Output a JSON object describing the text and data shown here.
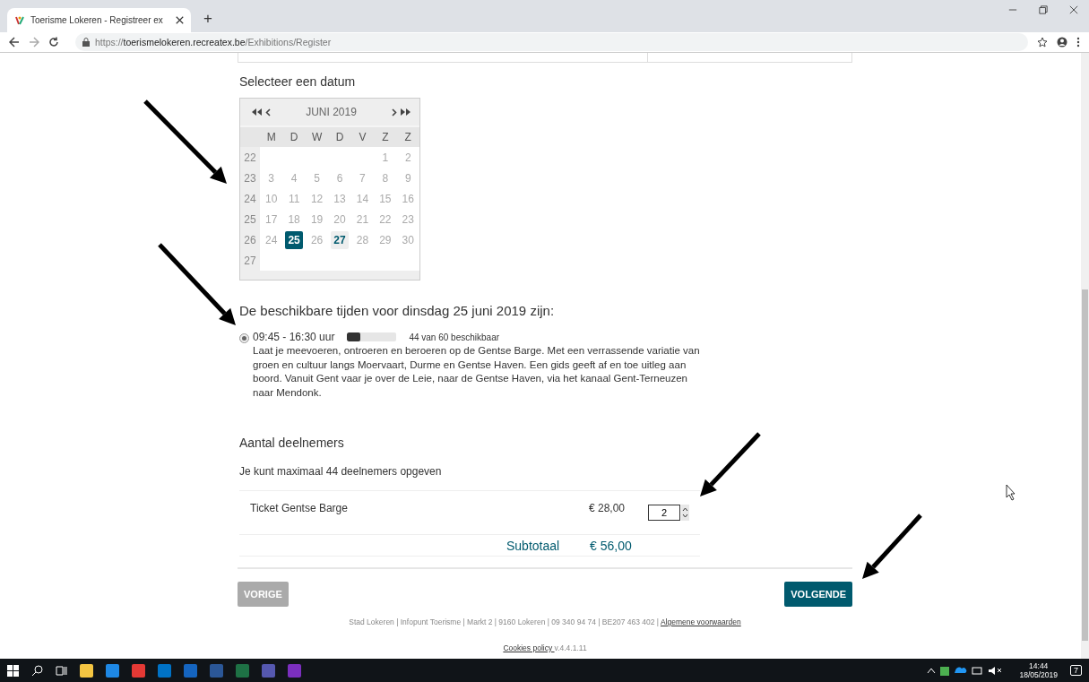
{
  "browser": {
    "tab_title": "Toerisme Lokeren - Registreer ex",
    "new_tab": "+",
    "url": {
      "scheme": "https://",
      "host": "toerismelokeren.recreatex.be",
      "path": "/Exhibitions/Register"
    }
  },
  "date_section": {
    "heading": "Selecteer een datum",
    "calendar": {
      "month": "JUNI 2019",
      "weekdays": [
        "M",
        "D",
        "W",
        "D",
        "V",
        "Z",
        "Z"
      ],
      "weeks": [
        {
          "number": "22",
          "days": [
            {
              "label": "1",
              "available": false,
              "selected": false
            },
            {
              "label": "2",
              "available": false,
              "selected": false
            }
          ]
        },
        {
          "number": "23",
          "days": [
            {
              "label": "3",
              "available": false,
              "selected": false
            },
            {
              "label": "4",
              "available": false,
              "selected": false
            },
            {
              "label": "5",
              "available": false,
              "selected": false
            },
            {
              "label": "6",
              "available": false,
              "selected": false
            },
            {
              "label": "7",
              "available": false,
              "selected": false
            },
            {
              "label": "8",
              "available": false,
              "selected": false
            },
            {
              "label": "9",
              "available": false,
              "selected": false
            }
          ]
        },
        {
          "number": "24",
          "days": [
            {
              "label": "10",
              "available": false,
              "selected": false
            },
            {
              "label": "11",
              "available": false,
              "selected": false
            },
            {
              "label": "12",
              "available": false,
              "selected": false
            },
            {
              "label": "13",
              "available": false,
              "selected": false
            },
            {
              "label": "14",
              "available": false,
              "selected": false
            },
            {
              "label": "15",
              "available": false,
              "selected": false
            },
            {
              "label": "16",
              "available": false,
              "selected": false
            }
          ]
        },
        {
          "number": "25",
          "days": [
            {
              "label": "17",
              "available": false,
              "selected": false
            },
            {
              "label": "18",
              "available": false,
              "selected": false
            },
            {
              "label": "19",
              "available": false,
              "selected": false
            },
            {
              "label": "20",
              "available": false,
              "selected": false
            },
            {
              "label": "21",
              "available": false,
              "selected": false
            },
            {
              "label": "22",
              "available": false,
              "selected": false
            },
            {
              "label": "23",
              "available": false,
              "selected": false
            }
          ]
        },
        {
          "number": "26",
          "days": [
            {
              "label": "24",
              "available": false,
              "selected": false
            },
            {
              "label": "25",
              "available": true,
              "selected": true
            },
            {
              "label": "26",
              "available": false,
              "selected": false
            },
            {
              "label": "27",
              "available": true,
              "selected": false
            },
            {
              "label": "28",
              "available": false,
              "selected": false
            },
            {
              "label": "29",
              "available": false,
              "selected": false
            },
            {
              "label": "30",
              "available": false,
              "selected": false
            }
          ]
        },
        {
          "number": "27"
        }
      ]
    }
  },
  "times_section": {
    "heading": "De beschikbare tijden voor dinsdag 25 juni 2019 zijn:",
    "slots": [
      {
        "time": "09:45 - 16:30 uur",
        "selected": true,
        "level": 0.27,
        "availability": "44 van 60 beschikbaar",
        "description": "Laat je meevoeren, ontroeren en beroeren op de Gentse Barge. Met een verrassende variatie van groen en cultuur langs Moervaart, Durme en Gentse Haven. Een gids geeft af en toe uitleg aan boord. Vanuit Gent vaar je over de Leie, naar de Gentse Haven, via het kanaal Gent-Terneuzen naar Mendonk."
      }
    ]
  },
  "participants": {
    "heading": "Aantal deelnemers",
    "note": "Je kunt maximaal 44 deelnemers opgeven",
    "tickets": [
      {
        "name": "Ticket Gentse Barge",
        "price": "€ 28,00",
        "quantity": "2"
      }
    ],
    "subtotal_label": "Subtotaal",
    "subtotal": "€ 56,00"
  },
  "buttons": {
    "back": "VORIGE",
    "next": "VOLGENDE"
  },
  "footer": {
    "text": "Stad Lokeren | Infopunt Toerisme | Markt 2 | 9160 Lokeren | 09 340 94 74 | BE207 463 402 |",
    "terms_link": "Algemene voorwaarden",
    "cookies_link": "Cookies policy ",
    "version": "v.4.4.1.11"
  },
  "taskbar": {
    "time": "14:44",
    "date": "18/05/2019",
    "notifications": "7"
  }
}
